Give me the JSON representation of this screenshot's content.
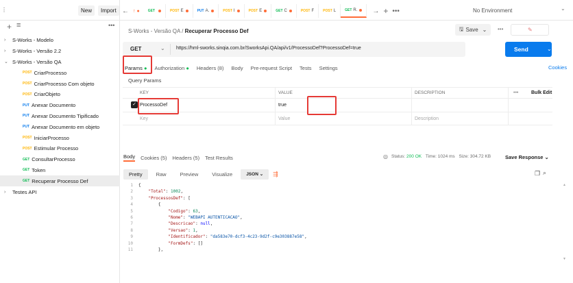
{
  "topbar": {
    "new_label": "New",
    "import_label": "Import",
    "tabs": [
      {
        "method": "GET",
        "title": "",
        "dot": true,
        "color": "#0cbb52"
      },
      {
        "method": "POST",
        "title": "E",
        "dot": true
      },
      {
        "method": "PUT",
        "title": "A.",
        "dot": true
      },
      {
        "method": "POST",
        "title": "I",
        "dot": true
      },
      {
        "method": "POST",
        "title": "E",
        "dot": true
      },
      {
        "method": "GET",
        "title": "C",
        "dot": true
      },
      {
        "method": "POST",
        "title": "F",
        "dot": false
      },
      {
        "method": "POST",
        "title": "L",
        "dot": false
      },
      {
        "method": "GET",
        "title": "R.",
        "dot": true
      }
    ],
    "environment": "No Environment"
  },
  "sidebar": {
    "items": [
      {
        "type": "folder",
        "label": "S-Works - Modelo",
        "expanded": false
      },
      {
        "type": "folder",
        "label": "S-Works - Versão 2.2",
        "expanded": false
      },
      {
        "type": "folder",
        "label": "S-Works - Versão QA",
        "expanded": true
      },
      {
        "type": "request",
        "method": "POST",
        "label": "CriarProcesso"
      },
      {
        "type": "request",
        "method": "POST",
        "label": "CriarProcesso Com objeto"
      },
      {
        "type": "request",
        "method": "POST",
        "label": "CriarObjeto"
      },
      {
        "type": "request",
        "method": "PUT",
        "label": "Anexar Documento"
      },
      {
        "type": "request",
        "method": "PUT",
        "label": "Anexar Documento Tipificado"
      },
      {
        "type": "request",
        "method": "PUT",
        "label": "Anexar Documento em objeto"
      },
      {
        "type": "request",
        "method": "POST",
        "label": "IniciarProcesso"
      },
      {
        "type": "request",
        "method": "POST",
        "label": "Estimular Processo"
      },
      {
        "type": "request",
        "method": "GET",
        "label": "ConsultarProcesso"
      },
      {
        "type": "request",
        "method": "GET",
        "label": "Token"
      },
      {
        "type": "request",
        "method": "GET",
        "label": "Recuperar Processo Def",
        "selected": true
      },
      {
        "type": "folder",
        "label": "Testes API",
        "expanded": false
      }
    ]
  },
  "request": {
    "breadcrumb_parent": "S-Works - Versão QA",
    "breadcrumb_sep": "/",
    "breadcrumb_current": "Recuperar Processo Def",
    "save_label": "Save",
    "method": "GET",
    "url": "https://hml-sworks.sinqia.com.br/SworksApi.QA/api/v1/ProcessoDef?ProcessoDef=true",
    "send_label": "Send",
    "tabs": {
      "params": "Params",
      "authorization": "Authorization",
      "headers": "Headers (8)",
      "body": "Body",
      "prerequest": "Pre-request Script",
      "tests": "Tests",
      "settings": "Settings"
    },
    "cookies_label": "Cookies",
    "query_params_title": "Query Params",
    "columns": {
      "key": "KEY",
      "value": "VALUE",
      "description": "DESCRIPTION"
    },
    "bulk_edit": "Bulk Edit",
    "param": {
      "key": "ProcessoDef",
      "value": "true",
      "checked": true
    },
    "placeholders": {
      "key": "Key",
      "value": "Value",
      "description": "Description"
    }
  },
  "response": {
    "tabs": {
      "body": "Body",
      "cookies": "Cookies (5)",
      "headers": "Headers (5)",
      "tests": "Test Results"
    },
    "status_label": "Status:",
    "status": "200 OK",
    "time": "Time: 1024 ms",
    "size": "Size: 304.72 KB",
    "save_response": "Save Response",
    "formats": {
      "pretty": "Pretty",
      "raw": "Raw",
      "preview": "Preview",
      "visualize": "Visualize",
      "json": "JSON"
    },
    "lines": [
      {
        "n": "1",
        "html": "<span class=\"ct\">{</span>"
      },
      {
        "n": "2",
        "html": "    <span class=\"k\">\"Total\"</span><span class=\"ct\">: </span><span class=\"n\">1002</span><span class=\"ct\">,</span>"
      },
      {
        "n": "3",
        "html": "    <span class=\"k\">\"ProcessosDef\"</span><span class=\"ct\">: [</span>"
      },
      {
        "n": "4",
        "html": "        <span class=\"ct\">{</span>"
      },
      {
        "n": "5",
        "html": "            <span class=\"k\">\"Codigo\"</span><span class=\"ct\">: </span><span class=\"n\">63</span><span class=\"ct\">,</span>"
      },
      {
        "n": "6",
        "html": "            <span class=\"k\">\"Nome\"</span><span class=\"ct\">: </span><span class=\"s\">\"WEBAPI AUTENTICACAO\"</span><span class=\"ct\">,</span>"
      },
      {
        "n": "7",
        "html": "            <span class=\"k\">\"Descricao\"</span><span class=\"ct\">: </span><span class=\"b\">null</span><span class=\"ct\">,</span>"
      },
      {
        "n": "8",
        "html": "            <span class=\"k\">\"Versao\"</span><span class=\"ct\">: </span><span class=\"n\">1</span><span class=\"ct\">,</span>"
      },
      {
        "n": "9",
        "html": "            <span class=\"k\">\"Identificador\"</span><span class=\"ct\">: </span><span class=\"s\">\"da583e70-dcf3-4c23-9d2f-c9e303887e58\"</span><span class=\"ct\">,</span>"
      },
      {
        "n": "10",
        "html": "            <span class=\"k\">\"FormDefs\"</span><span class=\"ct\">: []</span>"
      },
      {
        "n": "11",
        "html": "        <span class=\"ct\">},</span>"
      }
    ]
  }
}
